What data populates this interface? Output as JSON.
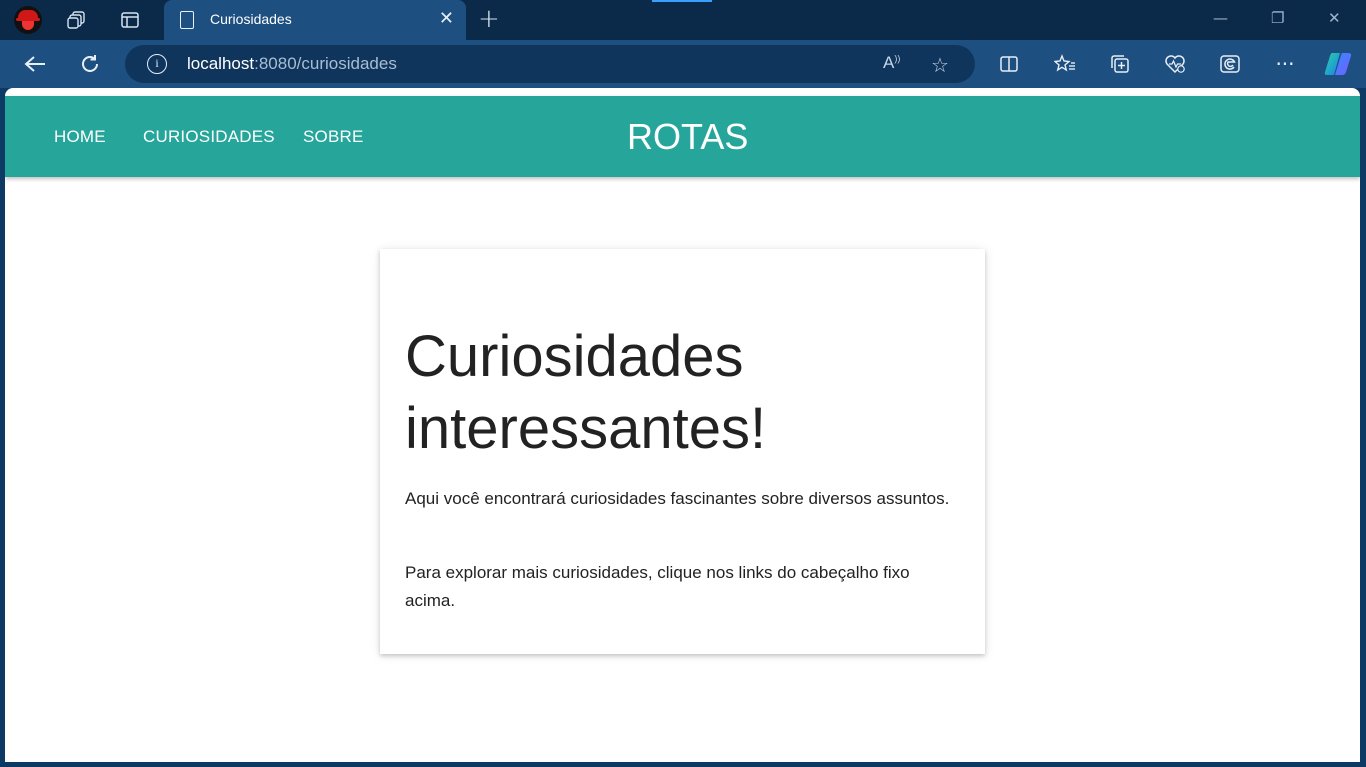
{
  "browser": {
    "tab_title": "Curiosidades",
    "url_host": "localhost",
    "url_rest": ":8080/curiosidades"
  },
  "header": {
    "nav": [
      {
        "label": "HOME"
      },
      {
        "label": "CURIOSIDADES"
      },
      {
        "label": "SOBRE"
      }
    ],
    "brand": "ROTAS",
    "color": "#26a69a"
  },
  "card": {
    "title": "Curiosidades interessantes!",
    "paragraphs": [
      "Aqui você encontrará curiosidades fascinantes sobre diversos assuntos.",
      "Para explorar mais curiosidades, clique nos links do cabeçalho fixo acima."
    ]
  },
  "icons": [
    "profile-avatar",
    "workspaces-icon",
    "tab-actions-icon",
    "document-icon",
    "close-icon",
    "new-tab-icon",
    "minimize-icon",
    "restore-icon",
    "window-close-icon",
    "back-icon",
    "refresh-icon",
    "info-icon",
    "read-aloud-icon",
    "favorite-star-icon",
    "split-screen-icon",
    "favorites-icon",
    "collections-icon",
    "browser-essentials-icon",
    "edge-bar-icon",
    "more-icon",
    "copilot-icon"
  ]
}
